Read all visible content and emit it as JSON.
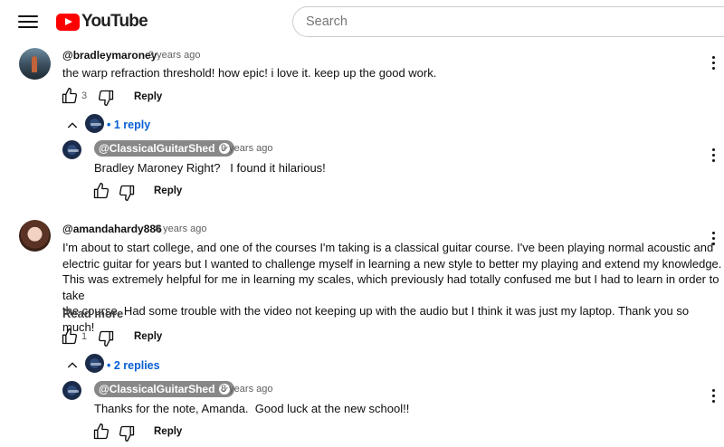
{
  "header": {
    "logo_text": "YouTube",
    "search_placeholder": "Search"
  },
  "comments": [
    {
      "author": "@bradleymaroney",
      "time": "9 years ago",
      "text": "the warp refraction threshold! how epic! i love it. keep up the good work.",
      "likes": "3",
      "reply_label": "Reply",
      "replies_link": "1 reply",
      "replies": [
        {
          "author": "@ClassicalGuitarShed",
          "time": "9 years ago",
          "text": "Bradley Maroney Right?   I found it hilarious!",
          "reply_label": "Reply"
        }
      ]
    },
    {
      "author": "@amandahardy886",
      "time": "8 years ago",
      "text_lines": [
        "I'm about to start college, and one of the courses I'm taking is a classical guitar course. I've been playing normal acoustic and",
        "electric guitar for years but I wanted to challenge myself in learning a new style to better my playing and extend my knowledge.",
        "This was extremely helpful for me in learning my scales, which previously had totally confused me but I had to learn in order to take",
        "the course. Had some trouble with the video not keeping up with the audio but I think it was just my laptop. Thank you so much!"
      ],
      "read_more": "Read more",
      "likes": "1",
      "reply_label": "Reply",
      "replies_link": "2 replies",
      "replies": [
        {
          "author": "@ClassicalGuitarShed",
          "time": "8 years ago",
          "text": "Thanks for the note, Amanda.  Good luck at the new school!!",
          "reply_label": "Reply"
        }
      ]
    }
  ],
  "icons": [
    "menu-icon",
    "youtube-logo-icon",
    "thumbs-up-icon",
    "thumbs-down-icon",
    "chevron-up-icon",
    "more-vert-icon",
    "verified-check-icon"
  ],
  "colors": {
    "brand_red": "#ff0000",
    "link_blue": "#065fd4",
    "chip_gray": "#888888"
  }
}
